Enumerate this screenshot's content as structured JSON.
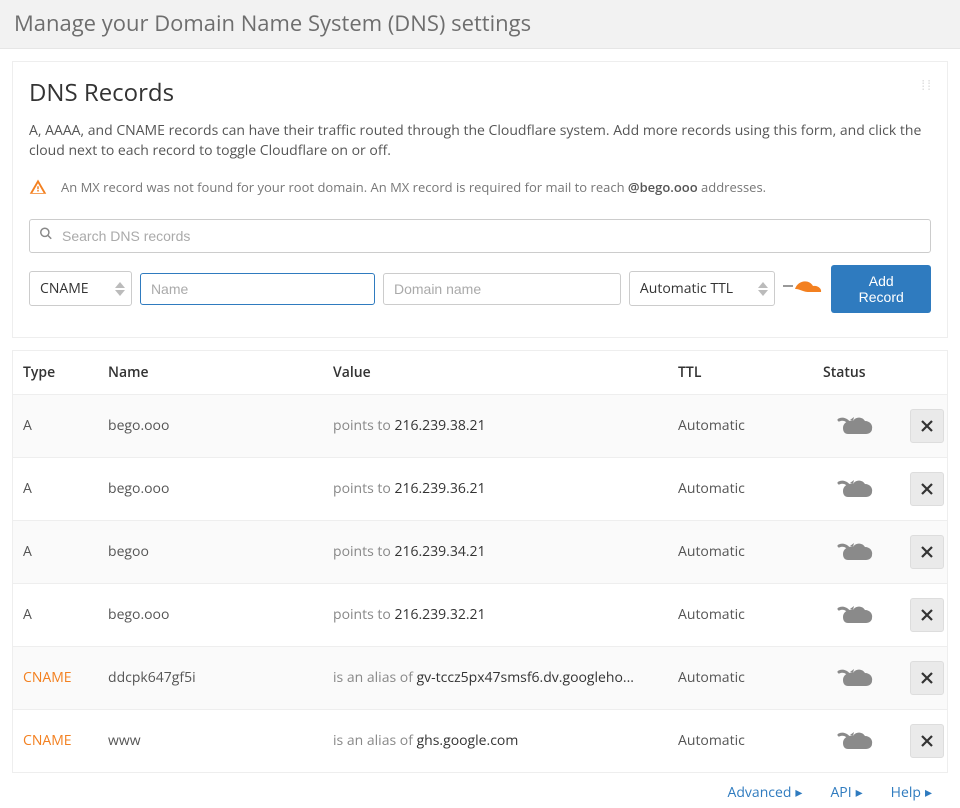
{
  "page_title": "Manage your Domain Name System (DNS) settings",
  "card": {
    "title": "DNS Records",
    "description": "A, AAAA, and CNAME records can have their traffic routed through the Cloudflare system. Add more records using this form, and click the cloud next to each record to toggle Cloudflare on or off.",
    "warning_prefix": "An MX record was not found for your root domain. An MX record is required for mail to reach ",
    "warning_domain": "@bego.ooo",
    "warning_suffix": " addresses."
  },
  "search_placeholder": "Search DNS records",
  "add_form": {
    "type_value": "CNAME",
    "name_placeholder": "Name",
    "domain_placeholder": "Domain name",
    "ttl_value": "Automatic TTL",
    "add_button": "Add Record"
  },
  "table": {
    "headers": {
      "type": "Type",
      "name": "Name",
      "value": "Value",
      "ttl": "TTL",
      "status": "Status"
    },
    "rows": [
      {
        "type": "A",
        "name": "bego.ooo",
        "value_prefix": "points to ",
        "value": "216.239.38.21",
        "ttl": "Automatic"
      },
      {
        "type": "A",
        "name": "bego.ooo",
        "value_prefix": "points to ",
        "value": "216.239.36.21",
        "ttl": "Automatic"
      },
      {
        "type": "A",
        "name": "begoo",
        "value_prefix": "points to ",
        "value": "216.239.34.21",
        "ttl": "Automatic"
      },
      {
        "type": "A",
        "name": "bego.ooo",
        "value_prefix": "points to ",
        "value": "216.239.32.21",
        "ttl": "Automatic"
      },
      {
        "type": "CNAME",
        "name": "ddcpk647gf5i",
        "value_prefix": "is an alias of ",
        "value": "gv-tccz5px47smsf6.dv.googleho...",
        "ttl": "Automatic"
      },
      {
        "type": "CNAME",
        "name": "www",
        "value_prefix": "is an alias of ",
        "value": "ghs.google.com",
        "ttl": "Automatic"
      }
    ]
  },
  "footer": {
    "advanced": "Advanced",
    "api": "API",
    "help": "Help"
  }
}
